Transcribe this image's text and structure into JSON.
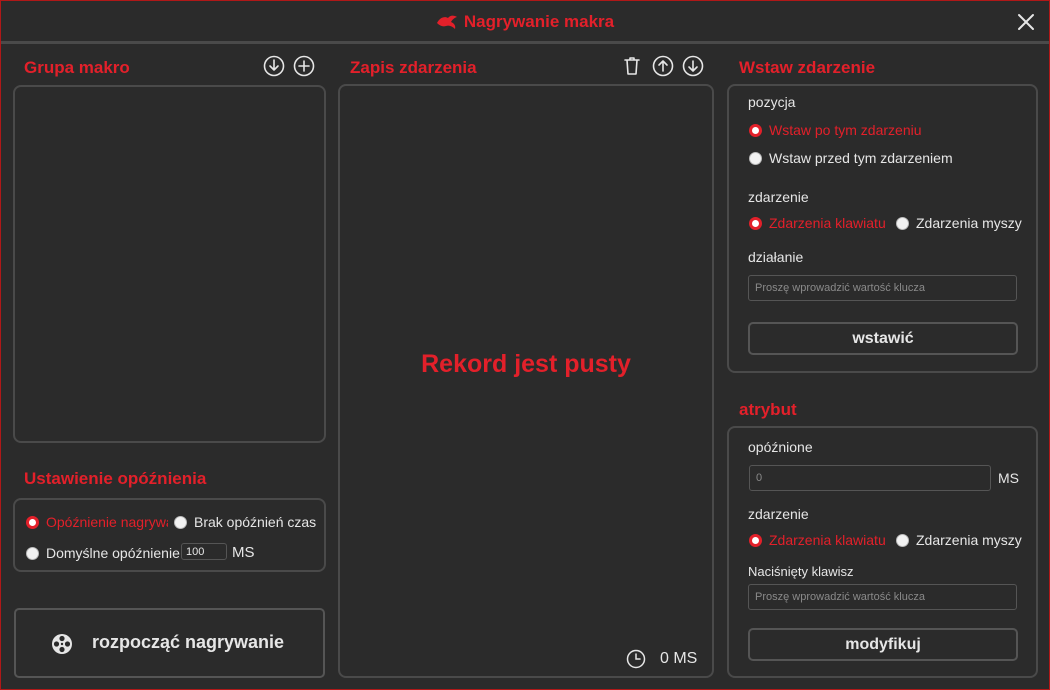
{
  "window": {
    "title": "Nagrywanie makra"
  },
  "group": {
    "title": "Grupa makro"
  },
  "delay_settings": {
    "title": "Ustawienie opóźnienia",
    "opt_recorded": "Opóźnienie nagrywania",
    "opt_none": "Brak opóźnień czasowych",
    "opt_default": "Domyślne opóźnienie",
    "default_value": "100",
    "unit": "MS"
  },
  "record_button": {
    "label": "rozpocząć nagrywanie"
  },
  "events": {
    "title": "Zapis zdarzenia",
    "empty_text": "Rekord jest pusty",
    "total_time": "0 MS"
  },
  "insert": {
    "title": "Wstaw zdarzenie",
    "position_label": "pozycja",
    "after": "Wstaw po tym zdarzeniu",
    "before": "Wstaw przed tym zdarzeniem",
    "event_label": "zdarzenie",
    "keyboard": "Zdarzenia klawiatu",
    "mouse": "Zdarzenia myszy",
    "action_label": "działanie",
    "key_placeholder": "Proszę wprowadzić wartość klucza",
    "insert_button": "wstawić"
  },
  "attribute": {
    "title": "atrybut",
    "delay_label": "opóźnione",
    "delay_value": "0",
    "unit": "MS",
    "event_label": "zdarzenie",
    "keyboard": "Zdarzenia klawiatu",
    "mouse": "Zdarzenia myszy",
    "key_label": "Naciśnięty klawisz",
    "key_placeholder": "Proszę wprowadzić wartość klucza",
    "modify_button": "modyfikuj"
  },
  "colors": {
    "accent": "#e3202a",
    "background": "#2b2b2b",
    "border": "#4a4a4a"
  }
}
